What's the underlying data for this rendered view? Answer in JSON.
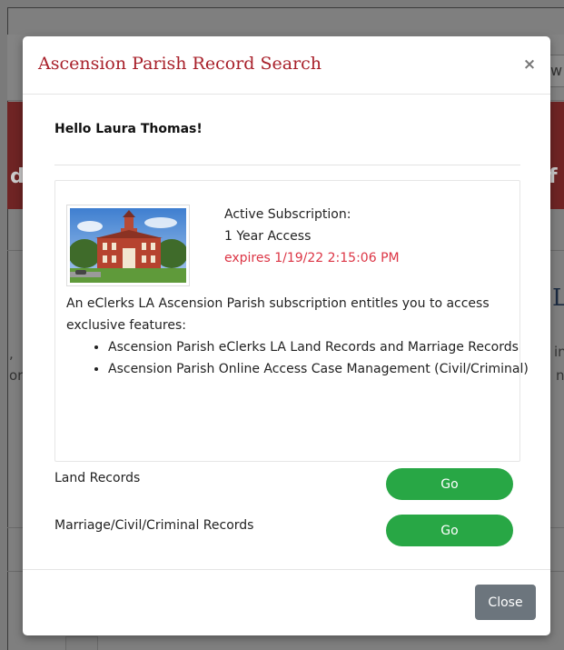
{
  "background": {
    "search_fragment": "w",
    "banner_left_fragment": "d",
    "banner_right_fragment": "f",
    "heading_fragment": "L",
    "left_fragments": [
      ",",
      "or"
    ],
    "right_fragments": [
      "in",
      "n"
    ]
  },
  "modal": {
    "title": "Ascension Parish Record Search",
    "close_icon": "close-icon",
    "close_glyph": "×",
    "greeting": "Hello Laura Thomas!",
    "subscription": {
      "image": "courthouse-photo",
      "status": "Active Subscription:",
      "term": "1 Year Access",
      "expiry": "expires 1/19/22 2:15:06 PM",
      "description": "An eClerks LA Ascension Parish subscription entitles you to access exclusive features:",
      "features": [
        "Ascension Parish eClerks LA Land Records and Marriage Records",
        "Ascension Parish Online Access Case Management (Civil/Criminal)"
      ]
    },
    "records": [
      {
        "label": "Land Records",
        "button": "Go"
      },
      {
        "label": "Marriage/Civil/Criminal Records",
        "button": "Go"
      }
    ],
    "footer": {
      "close_label": "Close"
    }
  },
  "colors": {
    "title_red": "#a8202a",
    "expiry_red": "#dc3545",
    "go_green": "#28a745",
    "close_gray": "#6c757d"
  }
}
